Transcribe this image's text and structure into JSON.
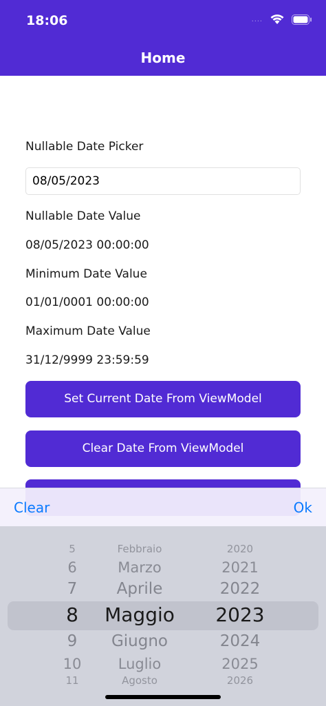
{
  "status_bar": {
    "time": "18:06",
    "signal": "....",
    "wifi_icon": "wifi-icon",
    "battery_icon": "battery-icon"
  },
  "nav": {
    "title": "Home"
  },
  "form": {
    "picker_label": "Nullable Date Picker",
    "picker_value": "08/05/2023",
    "nullable_label": "Nullable Date Value",
    "nullable_value": "08/05/2023 00:00:00",
    "min_label": "Minimum Date Value",
    "min_value": "01/01/0001 00:00:00",
    "max_label": "Maximum Date Value",
    "max_value": "31/12/9999 23:59:59"
  },
  "buttons": {
    "set_current": "Set Current Date From ViewModel",
    "clear_date": "Clear Date From ViewModel"
  },
  "picker": {
    "clear_label": "Clear",
    "ok_label": "Ok",
    "days": [
      "5",
      "6",
      "7",
      "8",
      "9",
      "10",
      "11"
    ],
    "months": [
      "Febbraio",
      "Marzo",
      "Aprile",
      "Maggio",
      "Giugno",
      "Luglio",
      "Agosto"
    ],
    "years": [
      "2020",
      "2021",
      "2022",
      "2023",
      "2024",
      "2025",
      "2026"
    ],
    "selected_index": 3
  },
  "colors": {
    "accent": "#512BD4",
    "link": "#0A7AFF"
  }
}
